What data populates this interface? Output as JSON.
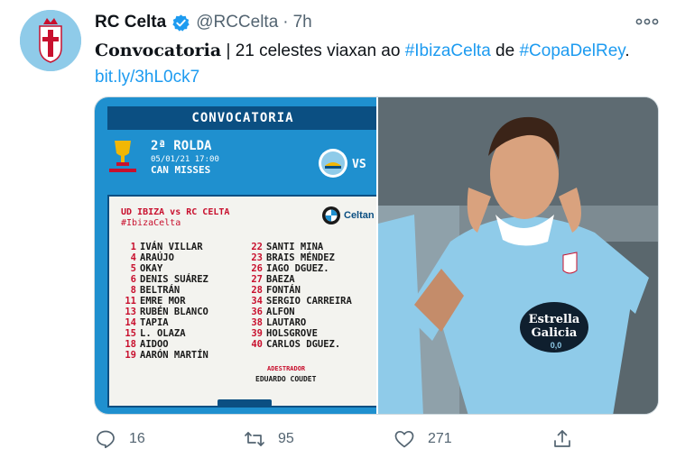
{
  "tweet": {
    "display_name": "RC Celta",
    "handle": "@RCCelta",
    "separator": "·",
    "time": "7h",
    "text_bold": "Convocatoria",
    "text_sep": " | 21 celestes viaxan ao ",
    "hashtag1": "#IbizaCelta",
    "text_mid": " de ",
    "hashtag2": "#CopaDelRey",
    "text_end": ".",
    "link": "bit.ly/3hL0ck7"
  },
  "poster": {
    "title": "CONVOCATORIA",
    "round": "2ª ROLDA",
    "round_info": "05/01/21 17:00",
    "venue": "CAN MISSES",
    "vs": "VS",
    "cup_caption": "COPADELREY",
    "match": "UD IBIZA vs RC CELTA",
    "tag": "#IbizaCelta",
    "sponsor": "Celtan",
    "players_left": [
      {
        "num": "1",
        "name": "IVÁN VILLAR"
      },
      {
        "num": "4",
        "name": "ARAÚJO"
      },
      {
        "num": "5",
        "name": "OKAY"
      },
      {
        "num": "6",
        "name": "DENIS SUÁREZ"
      },
      {
        "num": "8",
        "name": "BELTRÁN"
      },
      {
        "num": "11",
        "name": "EMRE MOR"
      },
      {
        "num": "13",
        "name": "RUBÉN BLANCO"
      },
      {
        "num": "14",
        "name": "TAPIA"
      },
      {
        "num": "15",
        "name": "L. OLAZA"
      },
      {
        "num": "18",
        "name": "AIDOO"
      },
      {
        "num": "19",
        "name": "AARÓN MARTÍN"
      }
    ],
    "players_right": [
      {
        "num": "22",
        "name": "SANTI MINA"
      },
      {
        "num": "23",
        "name": "BRAIS MÉNDEZ"
      },
      {
        "num": "26",
        "name": "IAGO DGUEZ."
      },
      {
        "num": "27",
        "name": "BAEZA"
      },
      {
        "num": "28",
        "name": "FONTÁN"
      },
      {
        "num": "34",
        "name": "SERGIO CARREIRA"
      },
      {
        "num": "36",
        "name": "ALFON"
      },
      {
        "num": "38",
        "name": "LAUTARO"
      },
      {
        "num": "39",
        "name": "HOLSGROVE"
      },
      {
        "num": "40",
        "name": "CARLOS DGUEZ."
      }
    ],
    "coach_label": "ADESTRADOR",
    "coach_name": "EDUARDO COUDET"
  },
  "photo": {
    "sponsor_line1": "Estrella",
    "sponsor_line2": "Galicia",
    "sponsor_line3": "0,0"
  },
  "actions": {
    "reply_count": "16",
    "retweet_count": "95",
    "like_count": "271"
  },
  "colors": {
    "link": "#1d9bf0",
    "secondary_text": "#536471",
    "poster_blue": "#1f90cf",
    "celta_sky": "#8fcbe9"
  }
}
